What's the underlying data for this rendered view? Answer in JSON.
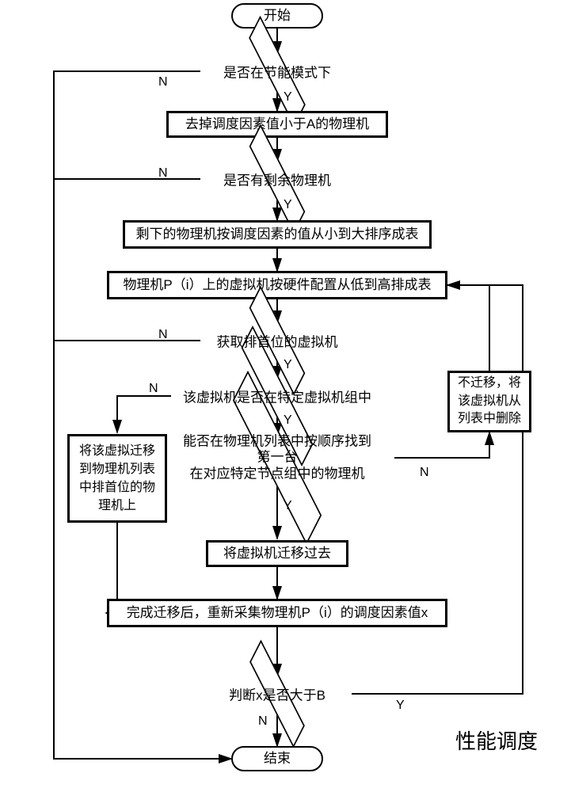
{
  "terminator": {
    "start": "开始",
    "end": "结束"
  },
  "decisions": {
    "d1": "是否在节能模式下",
    "d2": "是否有剩余物理机",
    "d3": "获取排首位的虚拟机",
    "d4": "该虚拟机是否在特定虚拟机组中",
    "d5_line1": "能否在物理机列表中按顺序找到第一台",
    "d5_line2": "在对应特定节点组中的物理机",
    "d6": "判断x是否大于B"
  },
  "processes": {
    "p1": "去掉调度因素值小于A的物理机",
    "p2": "剩下的物理机按调度因素的值从小到大排序成表",
    "p3": "物理机P（i）上的虚拟机按硬件配置从低到高排成表",
    "p4_l1": "将该虚拟迁移",
    "p4_l2": "到物理机列表",
    "p4_l3": "中排首位的物",
    "p4_l4": "理机上",
    "p5_l1": "不迁移，将",
    "p5_l2": "该虚拟机从",
    "p5_l3": "列表中删除",
    "p6": "将虚拟机迁移过去",
    "p7": "完成迁移后，重新采集物理机P（i）的调度因素值x"
  },
  "labels": {
    "Y": "Y",
    "N": "N"
  },
  "title": "性能调度"
}
